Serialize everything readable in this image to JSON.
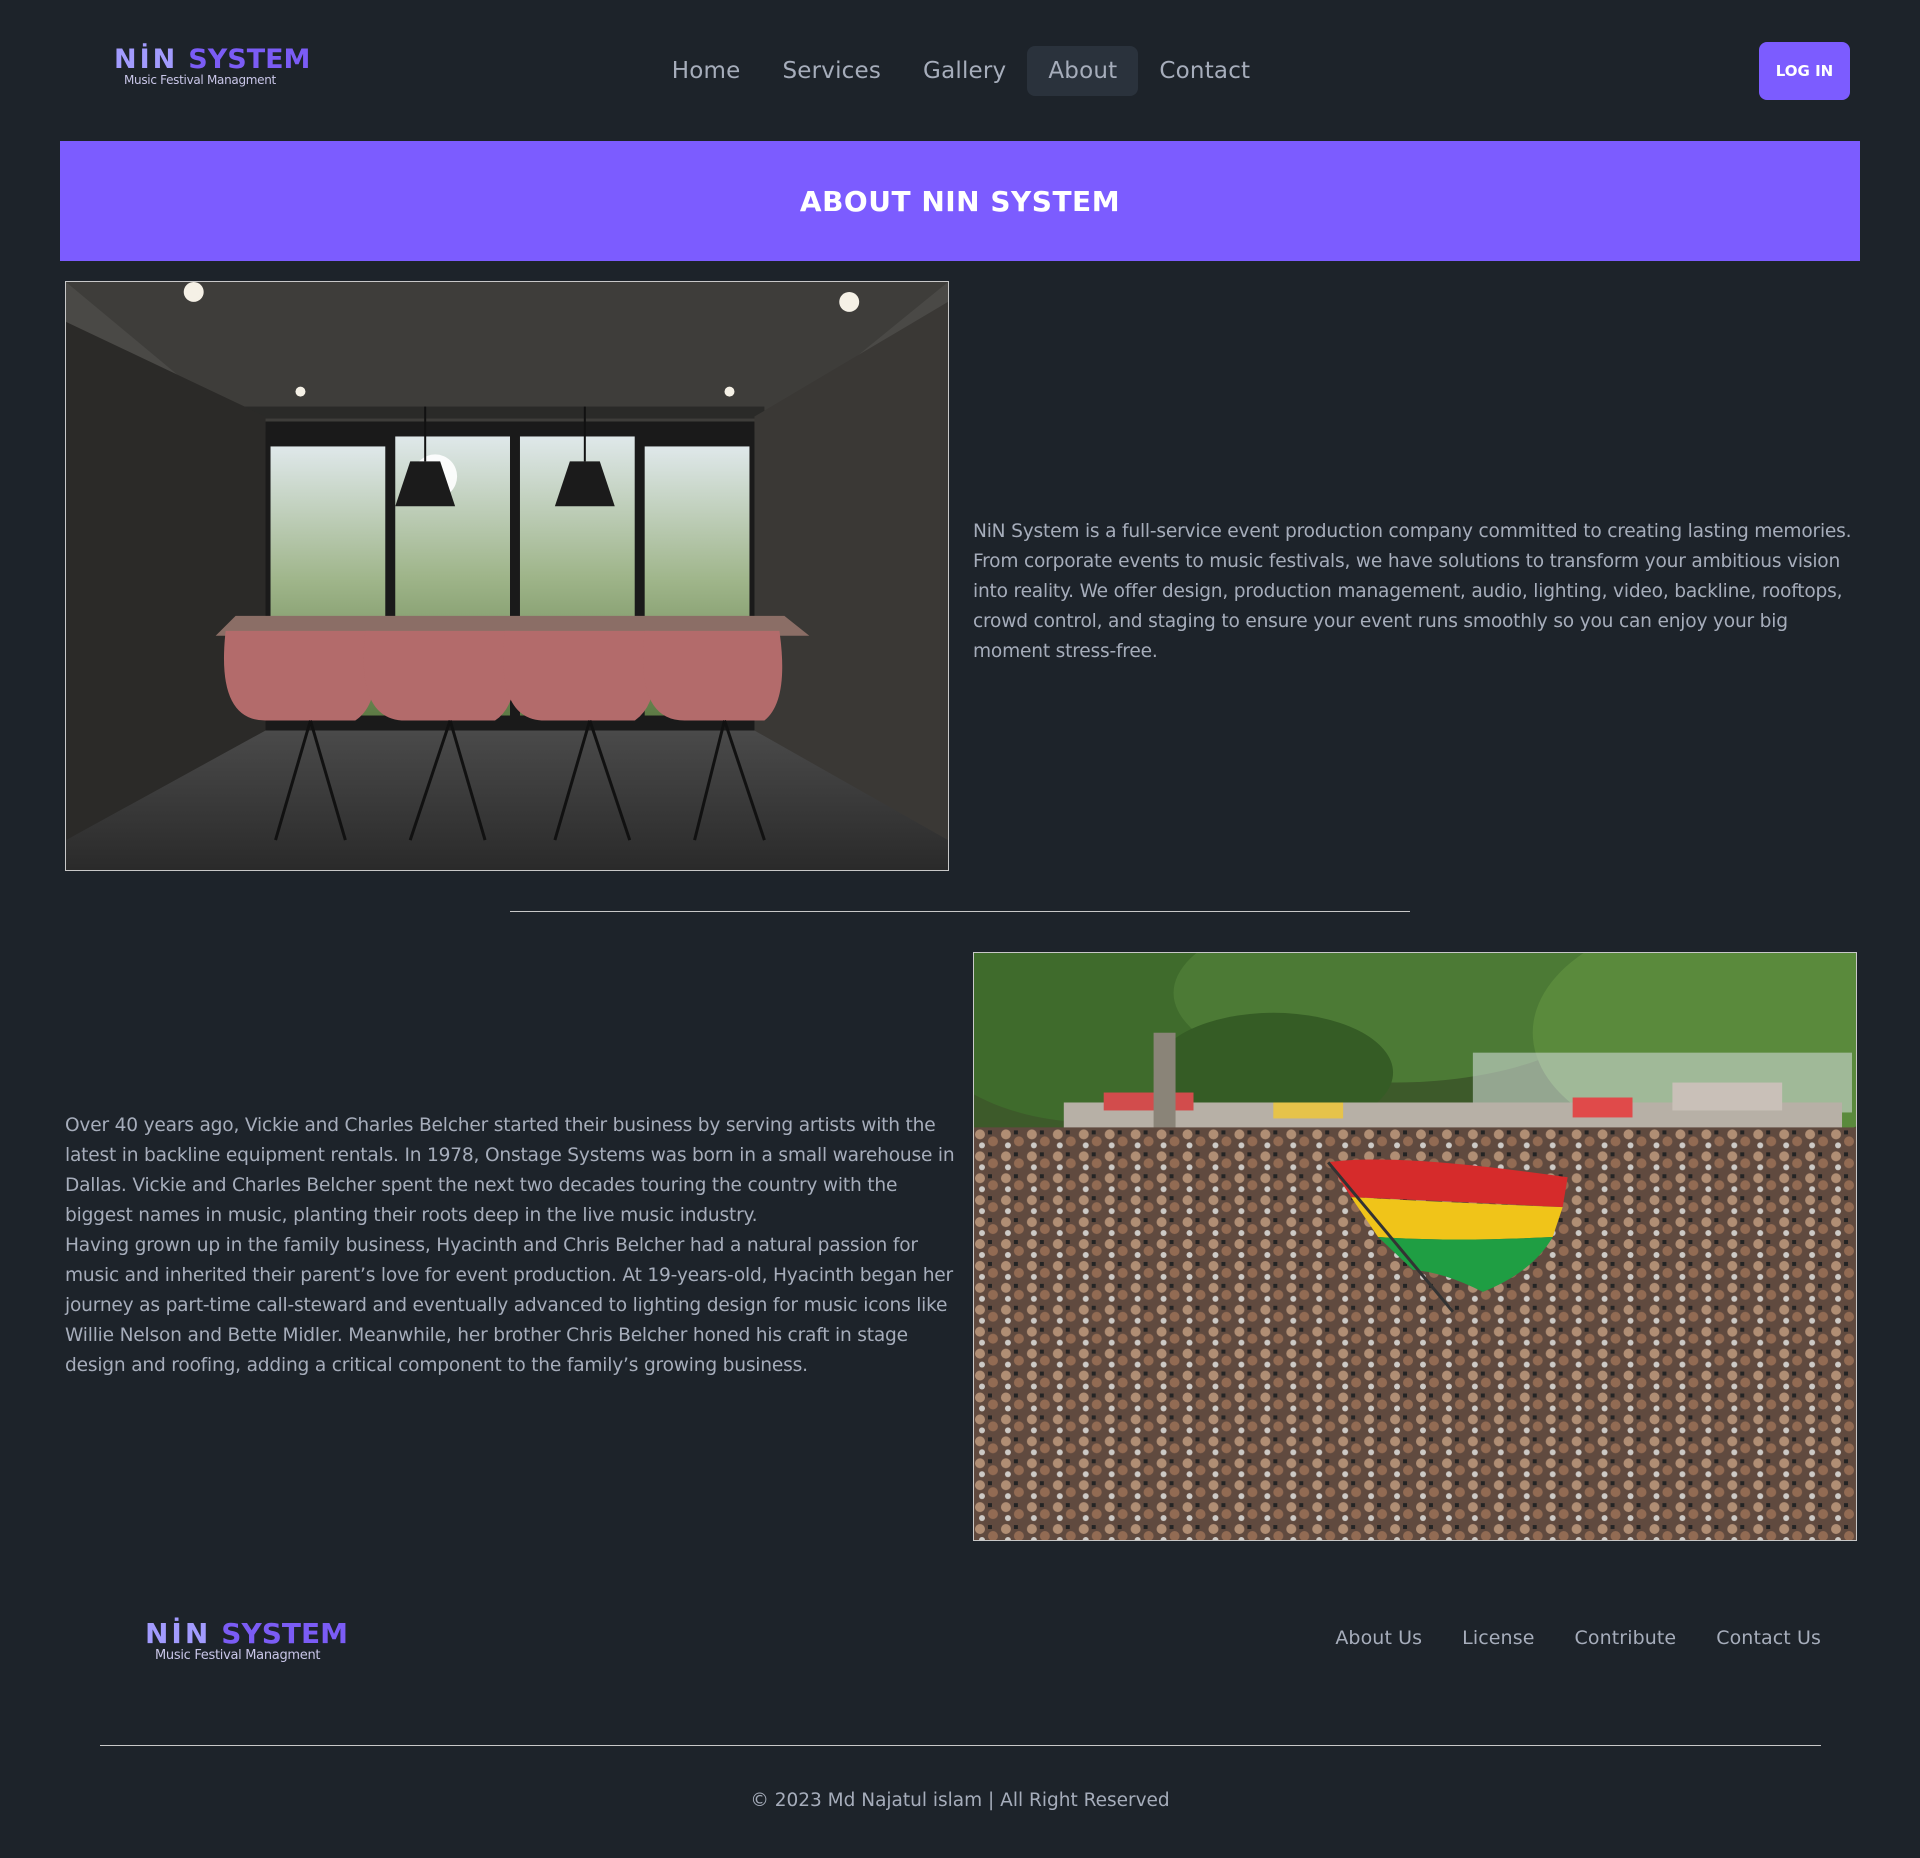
{
  "brand": {
    "name_first": "NİN",
    "name_second": "SYSTEM",
    "tagline": "Music Festival Managment",
    "accent_color": "#7c5cff"
  },
  "nav": {
    "items": [
      {
        "label": "Home",
        "active": false
      },
      {
        "label": "Services",
        "active": false
      },
      {
        "label": "Gallery",
        "active": false
      },
      {
        "label": "About",
        "active": true
      },
      {
        "label": "Contact",
        "active": false
      }
    ],
    "login_label": "LOG IN"
  },
  "banner": {
    "title": "ABOUT NIN SYSTEM"
  },
  "about": {
    "image_subject": "conference-room-photo",
    "text": "NiN System is a full-service event production company committed to creating lasting memories. From corporate events to music festivals, we have solutions to transform your ambitious vision into reality. We offer design, production management, audio, lighting, video, backline, rooftops, crowd control, and staging to ensure your event runs smoothly so you can enjoy your big moment stress-free."
  },
  "history": {
    "image_subject": "festival-crowd-photo",
    "paragraph_1": "Over 40 years ago, Vickie and Charles Belcher started their business by serving artists with the latest in backline equipment rentals. In 1978, Onstage Systems was born in a small warehouse in Dallas. Vickie and Charles Belcher spent the next two decades touring the country with the biggest names in music, planting their roots deep in the live music industry.",
    "paragraph_2": "Having grown up in the family business, Hyacinth and Chris Belcher had a natural passion for music and inherited their parent’s love for event production. At 19-years-old, Hyacinth began her journey as part-time call-steward and eventually advanced to lighting design for music icons like Willie Nelson and Bette Midler. Meanwhile, her brother Chris Belcher honed his craft in stage design and roofing, adding a critical component to the family’s growing business."
  },
  "footer": {
    "links": [
      "About Us",
      "License",
      "Contribute",
      "Contact Us"
    ],
    "copyright": "© 2023 Md Najatul islam | All Right Reserved"
  }
}
